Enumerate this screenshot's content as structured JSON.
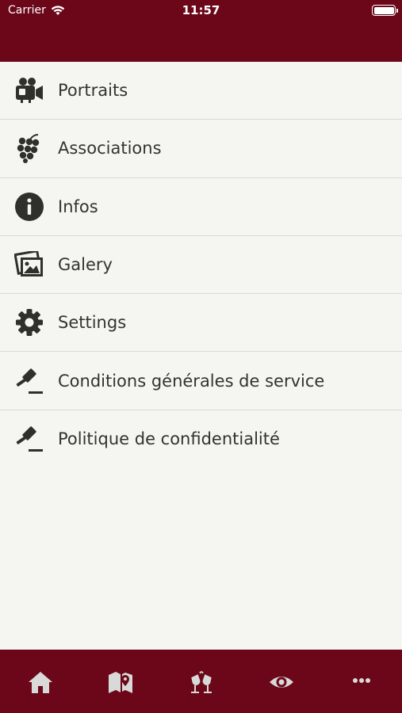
{
  "status_bar": {
    "carrier": "Carrier",
    "time": "11:57"
  },
  "colors": {
    "brand": "#6b0718",
    "background": "#f5f5f2",
    "icon": "#2f2f2c",
    "tab_icon": "#d9d9d9"
  },
  "menu": {
    "items": [
      {
        "label": "Portraits",
        "icon": "video-camera-icon"
      },
      {
        "label": "Associations",
        "icon": "grapes-icon"
      },
      {
        "label": "Infos",
        "icon": "info-icon"
      },
      {
        "label": "Galery",
        "icon": "gallery-icon"
      },
      {
        "label": "Settings",
        "icon": "gear-icon"
      },
      {
        "label": "Conditions générales de service",
        "icon": "gavel-icon"
      },
      {
        "label": "Politique de confidentialité",
        "icon": "gavel-icon"
      }
    ]
  },
  "tabbar": {
    "tabs": [
      {
        "icon": "home-icon"
      },
      {
        "icon": "map-icon"
      },
      {
        "icon": "wine-glasses-icon"
      },
      {
        "icon": "eye-icon"
      },
      {
        "icon": "more-icon"
      }
    ]
  }
}
